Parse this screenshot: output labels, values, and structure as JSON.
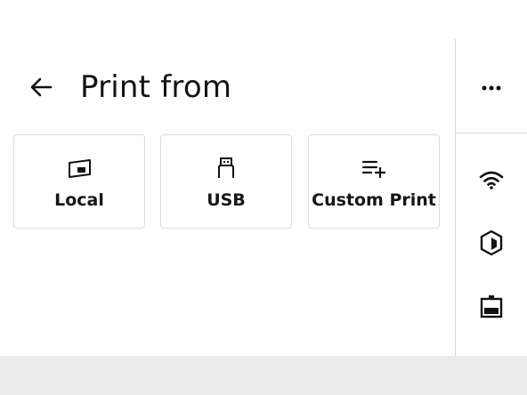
{
  "header": {
    "title": "Print from",
    "back_icon": "arrow-left-icon"
  },
  "sources": [
    {
      "label": "Local",
      "icon": "local-storage-icon"
    },
    {
      "label": "USB",
      "icon": "usb-icon"
    },
    {
      "label": "Custom Print",
      "icon": "playlist-add-icon"
    }
  ],
  "side_panel": {
    "icons": [
      "more-horizontal-icon",
      "wifi-icon",
      "cube-icon",
      "device-status-icon"
    ]
  },
  "colors": {
    "background": "#ffffff",
    "text": "#161616",
    "card_border": "#dcdcdc",
    "divider": "#d6d6d6",
    "bottom_strip": "#ececec"
  }
}
